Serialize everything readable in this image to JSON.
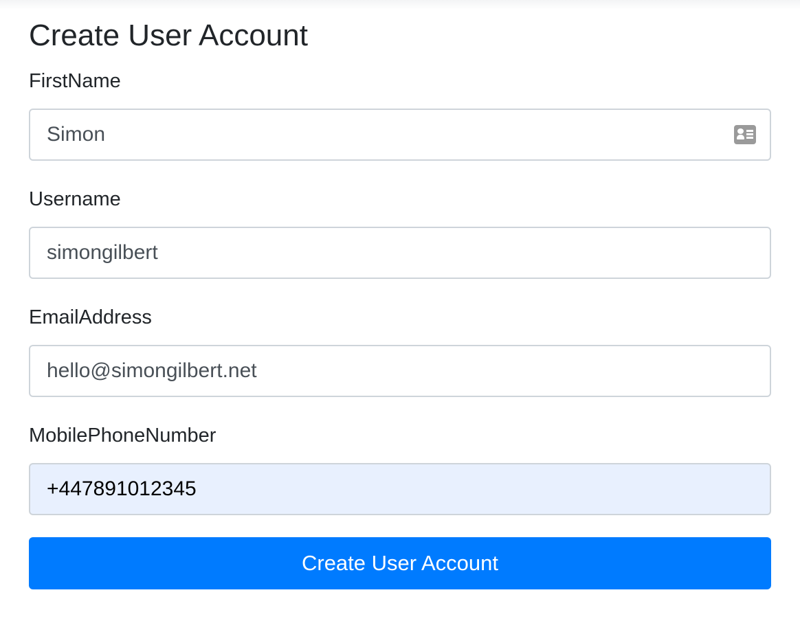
{
  "form": {
    "title": "Create User Account",
    "fields": [
      {
        "label": "FirstName",
        "value": "Simon"
      },
      {
        "label": "Username",
        "value": "simongilbert"
      },
      {
        "label": "EmailAddress",
        "value": "hello@simongilbert.net"
      },
      {
        "label": "MobilePhoneNumber",
        "value": "+447891012345"
      }
    ],
    "submit_label": "Create User Account"
  },
  "icons": {
    "first_name_field": "contact-card-icon"
  },
  "colors": {
    "primary_button": "#007bff",
    "autofill_background": "#e8f0fe",
    "input_border": "#ced4da"
  }
}
